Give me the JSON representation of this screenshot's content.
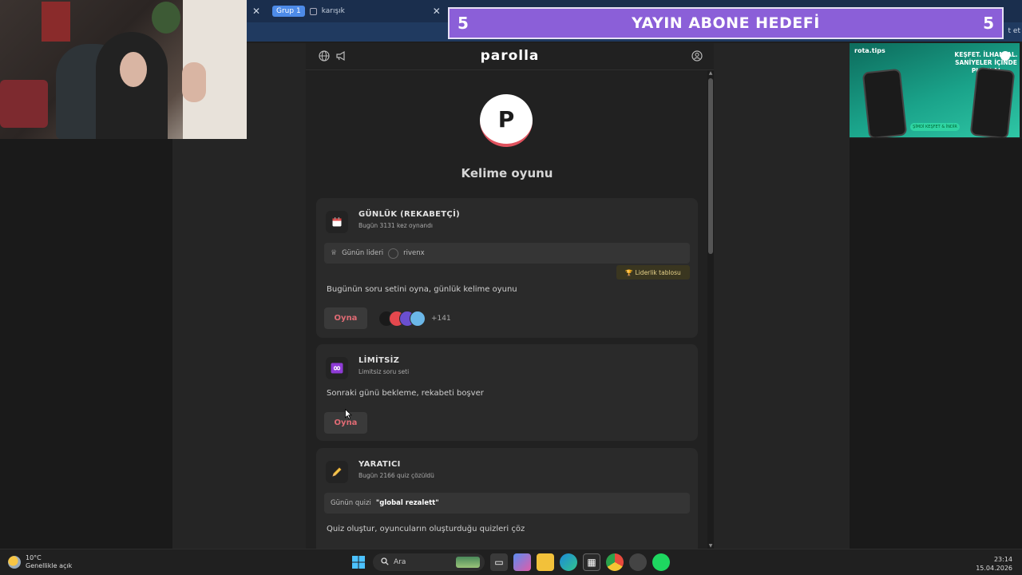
{
  "browser": {
    "tab_group": "Grup 1",
    "tab_title": "karışık",
    "subbar_text": "t et"
  },
  "goal": {
    "left_count": "5",
    "title": "YAYIN ABONE HEDEFİ",
    "right_count": "5"
  },
  "ad": {
    "brand": "rota.tips",
    "tagline": "KEŞFET. İLHAM AL. SANİYELER İÇİNDE PLANLA!",
    "cta": "ŞİMDİ KEŞFET & İNDİR"
  },
  "app": {
    "logo": "parolla",
    "avatar_letter": "P",
    "title": "Kelime oyunu"
  },
  "cards": {
    "daily": {
      "icon": "calendar-icon",
      "title": "GÜNLÜK (REKABETÇİ)",
      "subtitle": "Bugün 3131 kez oynandı",
      "leader_label": "Günün lideri",
      "leader_name": "rivenx",
      "leaderboard_label": "Liderlik tablosu",
      "description": "Bugünün soru setini oyna, günlük kelime oyunu",
      "play_label": "Oyna",
      "players_more": "+141"
    },
    "unlimited": {
      "icon": "infinity-icon",
      "title": "LİMİTSİZ",
      "subtitle": "Limitsiz soru seti",
      "description": "Sonraki günü bekleme, rekabeti boşver",
      "play_label": "Oyna"
    },
    "creator": {
      "icon": "pencil-icon",
      "title": "YARATICI",
      "subtitle": "Bugün 2166 quiz çözüldü",
      "quiz_label": "Günün quizi",
      "quiz_name": "\"global rezalett\"",
      "description": "Quiz oluştur, oyuncuların oluşturduğu quizleri çöz"
    }
  },
  "taskbar": {
    "temperature": "10°C",
    "weather": "Genellikle açık",
    "search_placeholder": "Ara",
    "time": "23:14",
    "date": "15.04.2026"
  },
  "colors": {
    "goal_bg": "#8b5fd8",
    "accent_red": "#e06b74",
    "page_bg": "#212121"
  }
}
